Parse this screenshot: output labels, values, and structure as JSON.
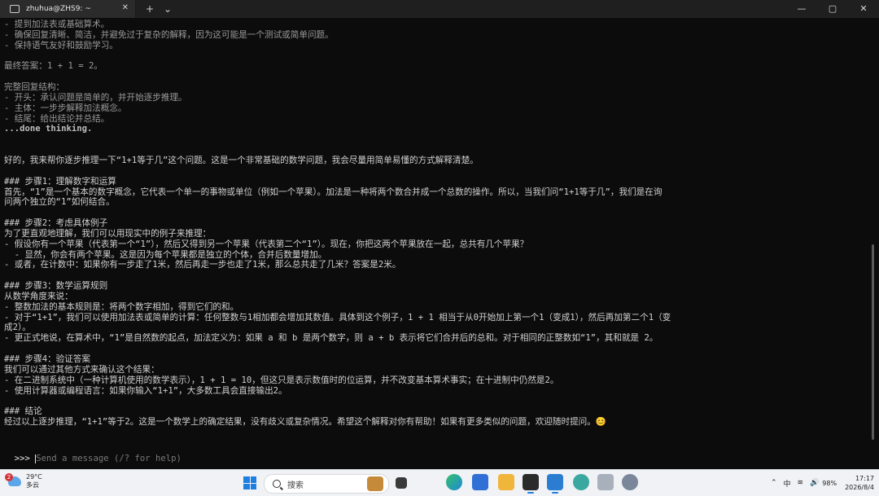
{
  "window": {
    "tab_title": "zhuhua@ZHS9: ~",
    "tab_close": "✕",
    "new_tab": "+",
    "dropdown": "⌄",
    "minimize": "—",
    "maximize": "▢",
    "close": "✕"
  },
  "terminal": {
    "lines": [
      {
        "text": "- 提到加法表或基础算术。",
        "style": "faint"
      },
      {
        "text": "- 确保回复清晰、简洁，并避免过于复杂的解释，因为这可能是一个测试或简单问题。",
        "style": "faint"
      },
      {
        "text": "- 保持语气友好和鼓励学习。",
        "style": "faint"
      },
      {
        "text": "",
        "style": "faint"
      },
      {
        "text": "最终答案：1 + 1 = 2。",
        "style": "faint"
      },
      {
        "text": "",
        "style": "faint"
      },
      {
        "text": "完整回复结构：",
        "style": "faint"
      },
      {
        "text": "- 开头：承认问题是简单的，并开始逐步推理。",
        "style": "faint"
      },
      {
        "text": "- 主体：一步步解释加法概念。",
        "style": "faint"
      },
      {
        "text": "- 结尾：给出结论并总结。",
        "style": "faint"
      },
      {
        "text": "...done thinking.",
        "style": "bold"
      },
      {
        "text": "",
        "style": ""
      },
      {
        "text": "",
        "style": ""
      },
      {
        "text": "好的，我来帮你逐步推理一下“1+1等于几”这个问题。这是一个非常基础的数学问题，我会尽量用简单易懂的方式解释清楚。",
        "style": ""
      },
      {
        "text": "",
        "style": ""
      },
      {
        "text": "### 步骤1：理解数字和运算",
        "style": ""
      },
      {
        "text": "首先，“1”是一个基本的数字概念，它代表一个单一的事物或单位（例如一个苹果）。加法是一种将两个数合并成一个总数的操作。所以，当我们问“1+1等于几”，我们是在询",
        "style": ""
      },
      {
        "text": "问两个独立的“1”如何结合。",
        "style": ""
      },
      {
        "text": "",
        "style": ""
      },
      {
        "text": "### 步骤2：考虑具体例子",
        "style": ""
      },
      {
        "text": "为了更直观地理解，我们可以用现实中的例子来推理：",
        "style": ""
      },
      {
        "text": "- 假设你有一个苹果（代表第一个“1”），然后又得到另一个苹果（代表第二个“1”）。现在，你把这两个苹果放在一起，总共有几个苹果？",
        "style": ""
      },
      {
        "text": "  - 显然，你会有两个苹果。这是因为每个苹果都是独立的个体，合并后数量增加。",
        "style": ""
      },
      {
        "text": "- 或者，在计数中：如果你有一步走了1米，然后再走一步也走了1米，那么总共走了几米？答案是2米。",
        "style": ""
      },
      {
        "text": "",
        "style": ""
      },
      {
        "text": "### 步骤3：数学运算规则",
        "style": ""
      },
      {
        "text": "从数学角度来说：",
        "style": ""
      },
      {
        "text": "- 整数加法的基本规则是：将两个数字相加，得到它们的和。",
        "style": ""
      },
      {
        "text": "- 对于“1+1”，我们可以使用加法表或简单的计算：任何整数与1相加都会增加其数值。具体到这个例子，1 + 1 相当于从0开始加上第一个1（变成1），然后再加第二个1（变",
        "style": ""
      },
      {
        "text": "成2）。",
        "style": ""
      },
      {
        "text": "- 更正式地说，在算术中，“1”是自然数的起点，加法定义为：如果 a 和 b 是两个数字，则 a + b 表示将它们合并后的总和。对于相同的正整数如“1”，其和就是 2。",
        "style": ""
      },
      {
        "text": "",
        "style": ""
      },
      {
        "text": "### 步骤4：验证答案",
        "style": ""
      },
      {
        "text": "我们可以通过其他方式来确认这个结果：",
        "style": ""
      },
      {
        "text": "- 在二进制系统中（一种计算机使用的数学表示），1 + 1 = 10，但这只是表示数值时的位运算，并不改变基本算术事实；在十进制中仍然是2。",
        "style": ""
      },
      {
        "text": "- 使用计算器或编程语言：如果你输入“1+1”，大多数工具会直接输出2。",
        "style": ""
      },
      {
        "text": "",
        "style": ""
      },
      {
        "text": "### 结论",
        "style": ""
      },
      {
        "text": "经过以上逐步推理，“1+1”等于2。这是一个数学上的确定结果，没有歧义或复杂情况。希望这个解释对你有帮助！如果有更多类似的问题，欢迎随时提问。😊",
        "style": ""
      }
    ],
    "prompt": ">>> ",
    "input_placeholder": "Send a message (/? for help)"
  },
  "taskbar": {
    "weather_badge": "2",
    "temperature": "29°C",
    "condition": "多云",
    "search_placeholder": "搜索",
    "tray_up": "⌃",
    "ime": "中",
    "wifi": "≋",
    "volume": "🔊",
    "battery": "98%",
    "time": "17:17",
    "date": "2026/8/4"
  }
}
